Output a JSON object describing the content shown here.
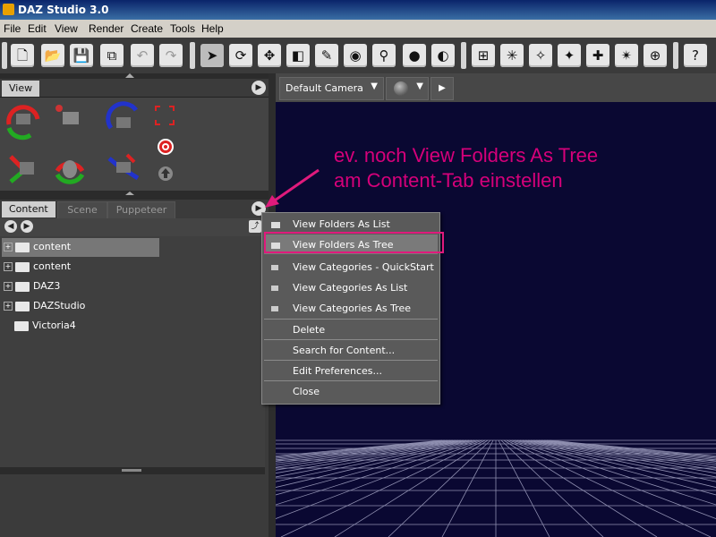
{
  "app": {
    "title": "DAZ Studio 3.0"
  },
  "menubar": {
    "items": [
      "File",
      "Edit",
      "View",
      "Render",
      "Create",
      "Tools",
      "Help"
    ]
  },
  "toolbar": {
    "icons": [
      "new-file-icon",
      "open-folder-icon",
      "save-icon",
      "merge-icon",
      "undo-icon",
      "redo-icon",
      "select-arrow-icon",
      "rotate-icon",
      "translate-icon",
      "scale-icon",
      "node-weight-icon",
      "camera-icon",
      "bone-icon",
      "render-sphere-icon",
      "render-settings-icon",
      "add-node-icon",
      "spotlight-icon",
      "point-light-icon",
      "distant-light-icon",
      "add-light-icon",
      "pose-icon",
      "add-camera-icon",
      "help-icon"
    ]
  },
  "view_panel": {
    "tab_label": "View"
  },
  "viewport": {
    "camera_label": "Default Camera"
  },
  "content_panel": {
    "tabs": [
      "Content",
      "Scene",
      "Puppeteer"
    ],
    "tree": [
      {
        "label": "content",
        "selected": true,
        "expandable": true
      },
      {
        "label": "content",
        "selected": false,
        "expandable": true
      },
      {
        "label": "DAZ3",
        "selected": false,
        "expandable": true
      },
      {
        "label": "DAZStudio",
        "selected": false,
        "expandable": true
      },
      {
        "label": "Victoria4",
        "selected": false,
        "expandable": false
      }
    ]
  },
  "context_menu": {
    "items": [
      {
        "label": "View Folders As List",
        "icon": "folder-icon"
      },
      {
        "label": "View Folders As Tree",
        "icon": "folder-icon"
      },
      {
        "label": "View Categories - QuickStart",
        "icon": "category-icon"
      },
      {
        "label": "View Categories As List",
        "icon": "category-icon"
      },
      {
        "label": "View Categories As Tree",
        "icon": "category-icon"
      },
      {
        "label": "Delete"
      },
      {
        "label": "Search for Content..."
      },
      {
        "label": "Edit Preferences..."
      },
      {
        "label": "Close"
      }
    ]
  },
  "annotation": {
    "line1": "ev. noch View Folders As Tree",
    "line2": "am Content-Tab  einstellen",
    "color": "#d6007a"
  }
}
